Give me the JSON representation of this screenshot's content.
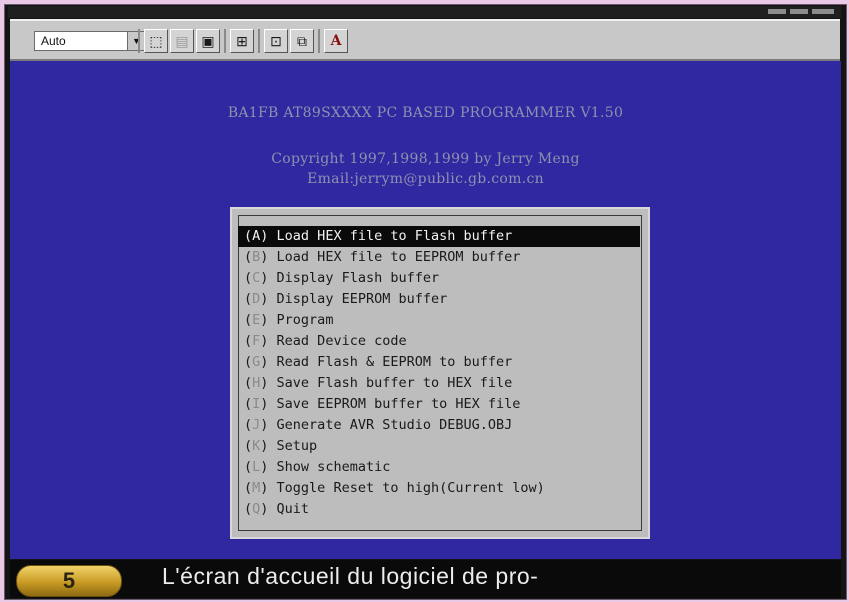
{
  "toolbar": {
    "font_select_value": "Auto",
    "buttons": [
      {
        "name": "mark-icon",
        "glyph": "⬚"
      },
      {
        "name": "copy-icon",
        "glyph": "▤"
      },
      {
        "name": "paste-icon",
        "glyph": "▣"
      },
      {
        "name": "fullscreen-icon",
        "glyph": "⊞"
      },
      {
        "name": "properties-icon",
        "glyph": "⊡"
      },
      {
        "name": "background-icon",
        "glyph": "⧉"
      },
      {
        "name": "font-icon",
        "glyph": "A"
      }
    ]
  },
  "console": {
    "header_line": "BA1FB AT89SXXXX PC BASED PROGRAMMER V1.50",
    "copyright_line": "Copyright 1997,1998,1999 by Jerry Meng",
    "email_line": "Email:jerrym@public.gb.com.cn",
    "menu_items": [
      {
        "key": "A",
        "label": "Load HEX file to Flash buffer",
        "selected": true
      },
      {
        "key": "B",
        "label": "Load HEX file to EEPROM buffer",
        "selected": false
      },
      {
        "key": "C",
        "label": "Display Flash buffer",
        "selected": false
      },
      {
        "key": "D",
        "label": "Display EEPROM buffer",
        "selected": false
      },
      {
        "key": "E",
        "label": "Program",
        "selected": false
      },
      {
        "key": "F",
        "label": "Read Device code",
        "selected": false
      },
      {
        "key": "G",
        "label": "Read Flash & EEPROM to buffer",
        "selected": false
      },
      {
        "key": "H",
        "label": "Save Flash buffer to HEX file",
        "selected": false
      },
      {
        "key": "I",
        "label": "Save EEPROM buffer to HEX file",
        "selected": false
      },
      {
        "key": "J",
        "label": "Generate AVR Studio DEBUG.OBJ",
        "selected": false
      },
      {
        "key": "K",
        "label": "Setup",
        "selected": false
      },
      {
        "key": "L",
        "label": "Show schematic",
        "selected": false
      },
      {
        "key": "M",
        "label": "Toggle Reset to high(Current low)",
        "selected": false
      },
      {
        "key": "Q",
        "label": "Quit",
        "selected": false
      }
    ]
  },
  "caption": {
    "step_number": "5",
    "text": "L'écran d'accueil du logiciel de pro-"
  },
  "colors": {
    "console_background": "#2f28a0",
    "menu_background": "#bdbdbd",
    "selection": "#0a0a0a",
    "badge": "#d8b040"
  }
}
